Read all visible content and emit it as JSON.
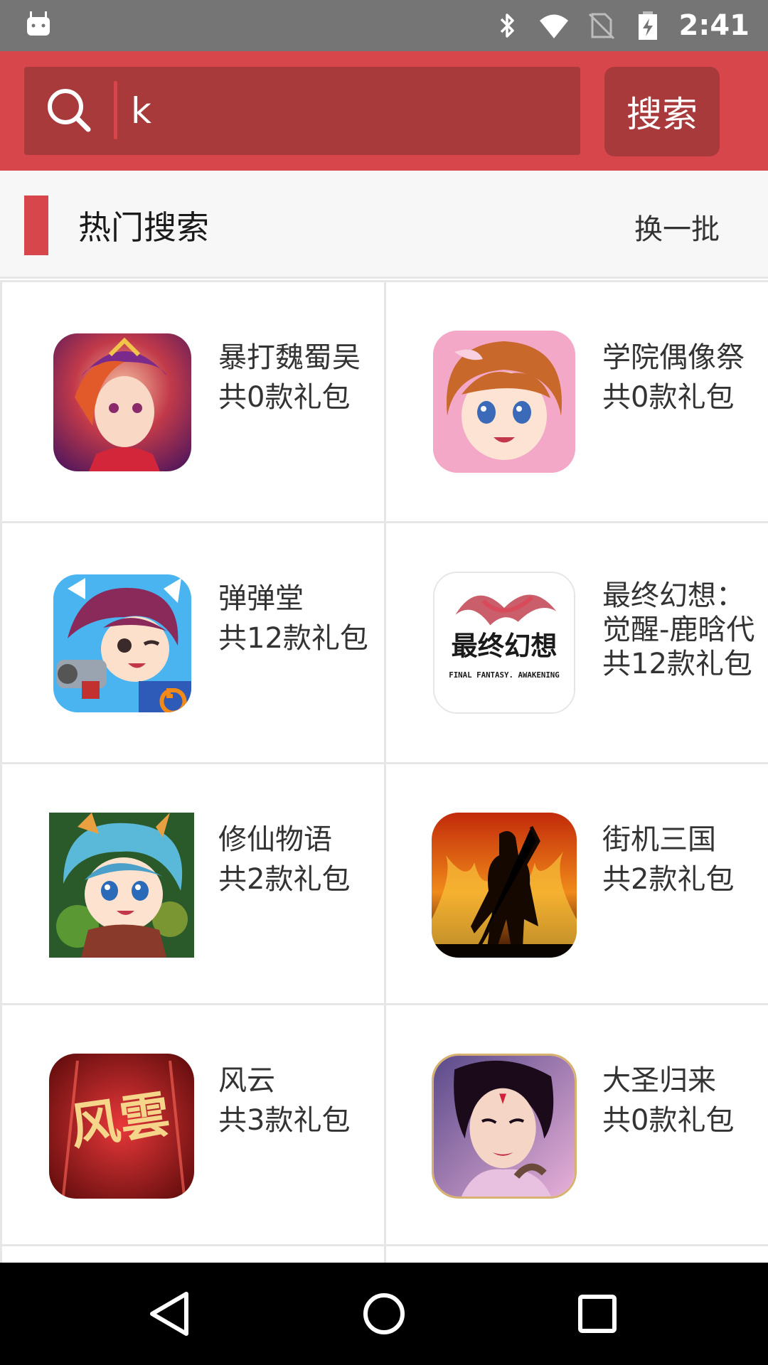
{
  "status_bar": {
    "time": "2:41",
    "icons": [
      "android-icon",
      "bluetooth-icon",
      "wifi-icon",
      "no-sim-icon",
      "battery-charging-icon"
    ]
  },
  "search": {
    "value": "k",
    "button_label": "搜索"
  },
  "hot_section": {
    "title": "热门搜索",
    "refresh_label": "换一批"
  },
  "games": [
    {
      "name": "暴打魏蜀吴",
      "count": "共0款礼包",
      "icon": "game-icon-baoda"
    },
    {
      "name": "学院偶像祭",
      "count": "共0款礼包",
      "icon": "game-icon-idol"
    },
    {
      "name": "弹弹堂",
      "count": "共12款礼包",
      "icon": "game-icon-ddt"
    },
    {
      "name": "最终幻想：",
      "name2": "觉醒-鹿晗代",
      "count": "共12款礼包",
      "icon": "game-icon-ff",
      "logo_text": "最终幻想",
      "logo_sub": "FINAL FANTASY. AWAKENING"
    },
    {
      "name": "修仙物语",
      "count": "共2款礼包",
      "icon": "game-icon-xiuxian"
    },
    {
      "name": "街机三国",
      "count": "共2款礼包",
      "icon": "game-icon-jieji"
    },
    {
      "name": "风云",
      "count": "共3款礼包",
      "icon": "game-icon-fengyun",
      "logo_text": "风雲"
    },
    {
      "name": "大圣归来",
      "count": "共0款礼包",
      "icon": "game-icon-dasheng"
    }
  ],
  "colors": {
    "header_red": "#d6464a",
    "search_box": "#a93a3c"
  },
  "nav": [
    "back-icon",
    "home-icon",
    "recents-icon"
  ]
}
